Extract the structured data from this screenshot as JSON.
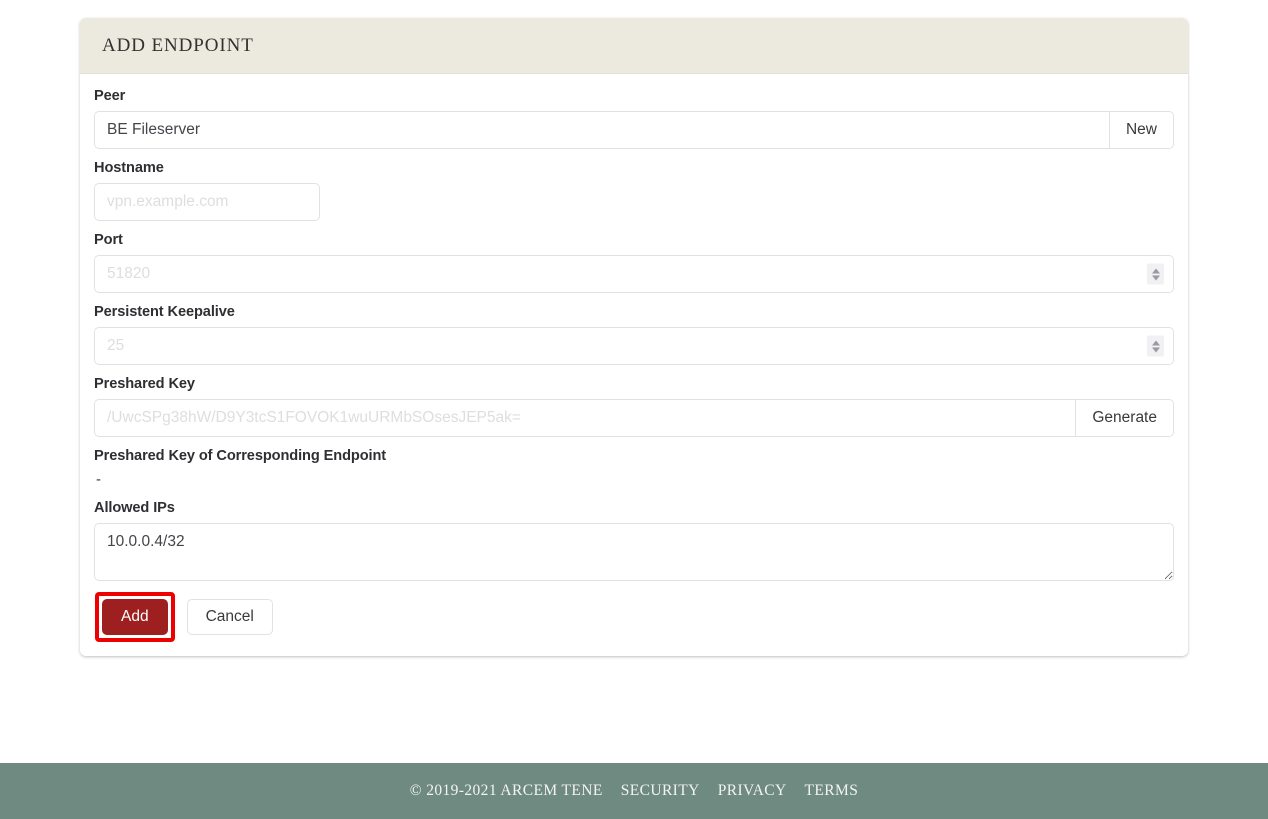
{
  "colors": {
    "accent_primary": "#9e1f20",
    "highlight_box": "#ee0000",
    "card_header_bg": "#eceadf",
    "footer_bg": "#6f8a81",
    "page_bg": "#ffffff"
  },
  "card": {
    "title": "ADD ENDPOINT"
  },
  "form": {
    "peer": {
      "label": "Peer",
      "value": "BE Fileserver",
      "placeholder": "",
      "addon_label": "New"
    },
    "hostname": {
      "label": "Hostname",
      "value": "",
      "placeholder": "vpn.example.com"
    },
    "port": {
      "label": "Port",
      "value": "",
      "placeholder": "51820",
      "spinner_up_icon": "chevron-up-icon",
      "spinner_down_icon": "chevron-down-icon"
    },
    "persistent_keepalive": {
      "label": "Persistent Keepalive",
      "value": "",
      "placeholder": "25",
      "spinner_up_icon": "chevron-up-icon",
      "spinner_down_icon": "chevron-down-icon"
    },
    "preshared_key": {
      "label": "Preshared Key",
      "value": "",
      "placeholder": "/UwcSPg38hW/D9Y3tcS1FOVOK1wuURMbSOsesJEP5ak=",
      "addon_label": "Generate"
    },
    "preshared_key_corresponding": {
      "label": "Preshared Key of Corresponding Endpoint",
      "value": "-"
    },
    "allowed_ips": {
      "label": "Allowed IPs",
      "value": "10.0.0.4/32",
      "placeholder": ""
    }
  },
  "actions": {
    "add_label": "Add",
    "cancel_label": "Cancel"
  },
  "footer": {
    "copyright": "© 2019-2021 ARCEM TENE",
    "links": [
      {
        "label": "SECURITY"
      },
      {
        "label": "PRIVACY"
      },
      {
        "label": "TERMS"
      }
    ]
  }
}
